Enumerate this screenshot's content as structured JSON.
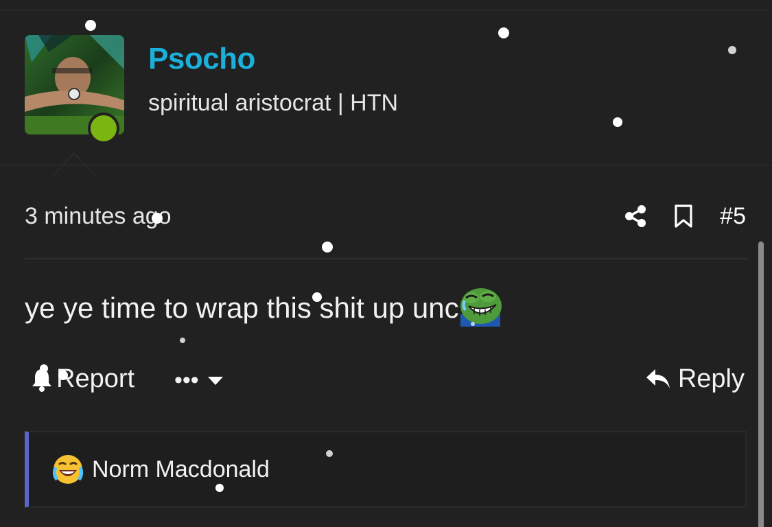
{
  "header": {
    "username": "Psocho",
    "user_title": "spiritual aristocrat | HTN"
  },
  "post": {
    "timestamp": "3 minutes ago",
    "post_number": "#5",
    "message": "ye ye time to wrap this shit up unc",
    "emoji": "pepe-laughing-crying"
  },
  "actions": {
    "report_label": "Report",
    "more_label": "•••",
    "reply_label": "Reply"
  },
  "reaction": {
    "emoji": "😹",
    "users": "Norm Macdonald"
  },
  "icons": {
    "share": "share-icon",
    "bookmark": "bookmark-icon",
    "bell": "bell-icon",
    "reply": "reply-arrow-icon",
    "caret": "caret-down-icon"
  },
  "colors": {
    "background": "#212121",
    "username": "#1ab0d9",
    "online": "#7ab512",
    "reaction_accent": "#5b66c7"
  }
}
